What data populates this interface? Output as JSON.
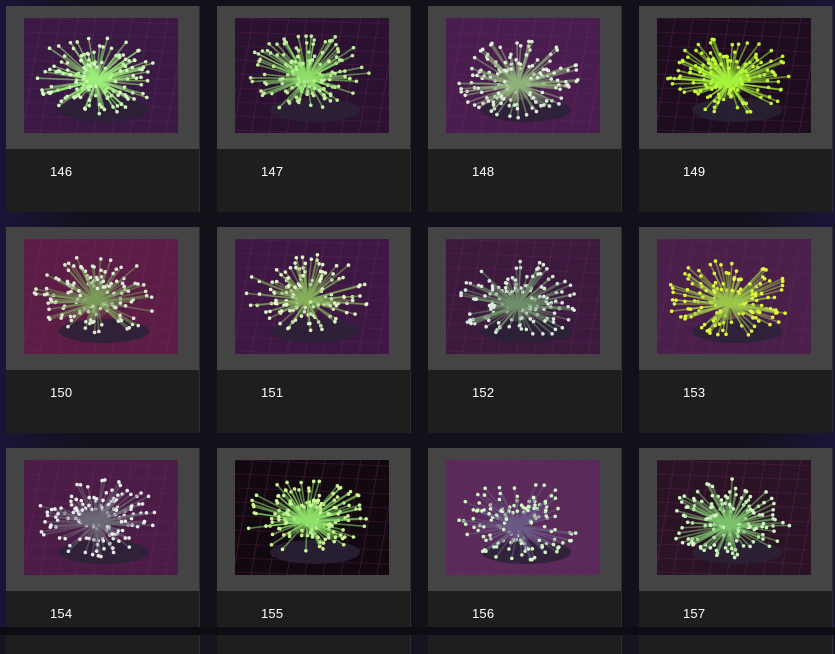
{
  "gallery": {
    "items": [
      {
        "label": "146",
        "glow": "#9df07a",
        "tip": "#d8ffc4",
        "bg": "#3a1a44"
      },
      {
        "label": "147",
        "glow": "#8fe06a",
        "tip": "#c8f5a2",
        "bg": "#2a1230"
      },
      {
        "label": "148",
        "glow": "#8fb27a",
        "tip": "#e6f6e0",
        "bg": "#4a1d4f"
      },
      {
        "label": "149",
        "glow": "#a6f23c",
        "tip": "#c8ff3a",
        "bg": "#1e0d1f"
      },
      {
        "label": "150",
        "glow": "#7c9a5c",
        "tip": "#e6f2da",
        "bg": "#5b1d45"
      },
      {
        "label": "151",
        "glow": "#86b05a",
        "tip": "#e7ffd0",
        "bg": "#3d1842"
      },
      {
        "label": "152",
        "glow": "#6f8f6a",
        "tip": "#e2f2e6",
        "bg": "#3b1a3d"
      },
      {
        "label": "153",
        "glow": "#9cc64a",
        "tip": "#e6ff3a",
        "bg": "#4a1f4a"
      },
      {
        "label": "154",
        "glow": "#6e6b78",
        "tip": "#f2f5f4",
        "bg": "#4a1c46"
      },
      {
        "label": "155",
        "glow": "#8ee06a",
        "tip": "#d6ff9a",
        "bg": "#120910"
      },
      {
        "label": "156",
        "glow": "#6b5a86",
        "tip": "#d7ffc7",
        "bg": "#5a2b5a"
      },
      {
        "label": "157",
        "glow": "#7cc26c",
        "tip": "#d9ffcc",
        "bg": "#2b1326"
      }
    ]
  }
}
